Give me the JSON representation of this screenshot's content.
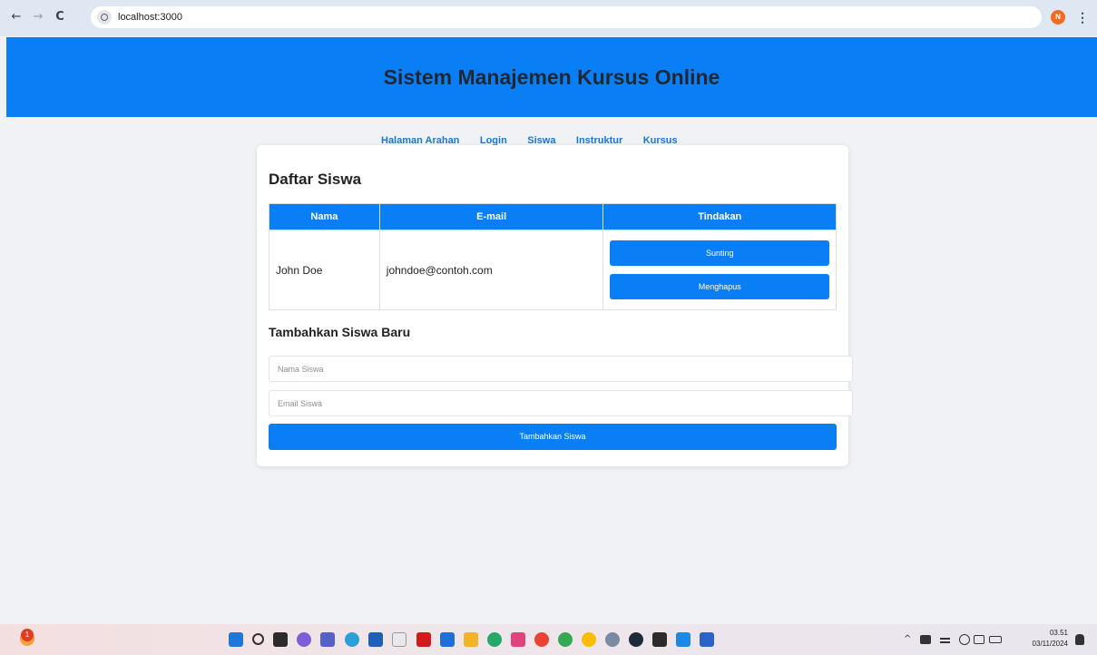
{
  "browser": {
    "url": "localhost:3000",
    "profile_initial": "N",
    "menu_glyph": "⋮",
    "back_glyph": "←",
    "forward_glyph": "→",
    "reload_glyph": "C"
  },
  "header": {
    "title": "Sistem Manajemen Kursus Online",
    "color": "#0a7ff5"
  },
  "nav": {
    "items": [
      "Halaman Arahan",
      "Login",
      "Siswa",
      "Instruktur",
      "Kursus"
    ]
  },
  "students": {
    "title": "Daftar Siswa",
    "columns": [
      "Nama",
      "E-mail",
      "Tindakan"
    ],
    "rows": [
      {
        "name": "John Doe",
        "email": "johndoe@contoh.com",
        "edit_label": "Sunting",
        "delete_label": "Menghapus"
      }
    ]
  },
  "add_form": {
    "title": "Tambahkan Siswa Baru",
    "name_placeholder": "Nama Siswa",
    "email_placeholder": "Email Siswa",
    "name_value": "",
    "email_value": "",
    "submit_label": "Tambahkan Siswa"
  },
  "taskbar": {
    "notification_count": "1",
    "time": "03.51",
    "date": "03/11/2024",
    "tray_chevron": "^"
  }
}
